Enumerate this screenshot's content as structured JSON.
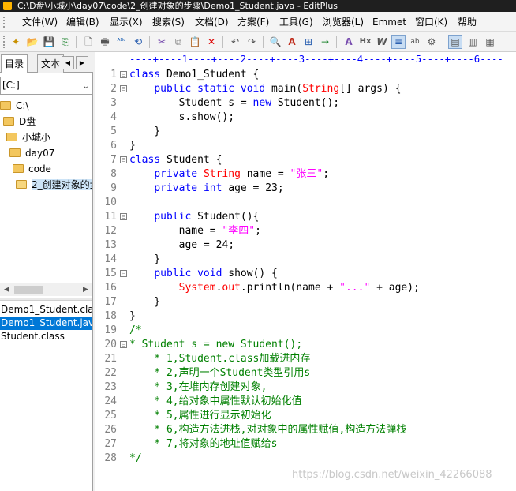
{
  "window": {
    "title": "C:\\D盘\\小城小\\day07\\code\\2_创建对象的步骤\\Demo1_Student.java - EditPlus"
  },
  "menu": [
    "文件(W)",
    "编辑(B)",
    "显示(X)",
    "搜索(S)",
    "文档(D)",
    "方案(F)",
    "工具(G)",
    "浏览器(L)",
    "Emmet",
    "窗口(K)",
    "帮助"
  ],
  "toolbar": {
    "icons": [
      "new-file-icon",
      "open-file-icon",
      "save-icon",
      "save-all-icon",
      "print-preview-icon",
      "print-icon",
      "spell-check-icon",
      "browser-view-icon",
      "cut-icon",
      "copy-icon",
      "paste-icon",
      "delete-icon",
      "undo-icon",
      "redo-icon",
      "find-icon",
      "replace-icon",
      "find-in-files-icon",
      "goto-line-icon",
      "font-icon",
      "hex-viewer-icon",
      "word-wrap-icon",
      "cliptext-icon",
      "spell-icon",
      "settings-icon",
      "layout-one-icon",
      "layout-two-icon",
      "layout-three-icon"
    ],
    "glyphs": [
      "✦",
      "📂",
      "💾",
      "⎘",
      "🗋",
      "🖶",
      "ᴬᴮᶜ",
      "⟲",
      "✂",
      "⧉",
      "📋",
      "✕",
      "↶",
      "↷",
      "🔍",
      "A",
      "⊞",
      "→",
      "A",
      "Hx",
      "W",
      "≡",
      "ab",
      "⚙",
      "▤",
      "▥",
      "▦"
    ]
  },
  "sidebar": {
    "tabs": [
      "目录",
      "文本"
    ],
    "drive": "[C:]",
    "folders": [
      "C:\\",
      "D盘",
      "小城小",
      "day07",
      "code",
      "2_创建对象的步"
    ],
    "files": [
      "Demo1_Student.class",
      "Demo1_Student.java",
      "Student.class"
    ]
  },
  "editor": {
    "ruler": "----+----1----+----2----+----3----+----4----+----5----+----6----",
    "line_numbers": [
      "1",
      "2",
      "3",
      "4",
      "5",
      "6",
      "7",
      "8",
      "9",
      "10",
      "11",
      "12",
      "13",
      "14",
      "15",
      "16",
      "17",
      "18",
      "19",
      "20",
      "21",
      "22",
      "23",
      "24",
      "25",
      "26",
      "27",
      "28"
    ],
    "fold_marks": [
      "⊟",
      "⊟",
      "",
      "",
      "",
      "",
      "⊟",
      "",
      "",
      "",
      "⊟",
      "",
      "",
      "",
      "⊟",
      "",
      "",
      "",
      "",
      "⊟",
      "",
      "",
      "",
      "",
      "",
      "",
      "",
      ""
    ],
    "lines": [
      "class Demo1_Student {",
      "    public static void main(String[] args) {",
      "        Student s = new Student();",
      "        s.show();",
      "    }",
      "}",
      "class Student {",
      "    private String name = \"张三\";",
      "    private int age = 23;",
      "",
      "    public Student(){",
      "        name = \"李四\";",
      "        age = 24;",
      "    }",
      "    public void show() {",
      "        System.out.println(name + \"...\" + age);",
      "    }",
      "}",
      "/*",
      "* Student s = new Student();",
      "    * 1,Student.class加载进内存",
      "    * 2,声明一个Student类型引用s",
      "    * 3,在堆内存创建对象,",
      "    * 4,给对象中属性默认初始化值",
      "    * 5,属性进行显示初始化",
      "    * 6,构造方法进栈,对对象中的属性赋值,构造方法弹栈",
      "    * 7,将对象的地址值赋给s",
      "*/"
    ]
  },
  "watermark": "https://blog.csdn.net/weixin_42266088"
}
